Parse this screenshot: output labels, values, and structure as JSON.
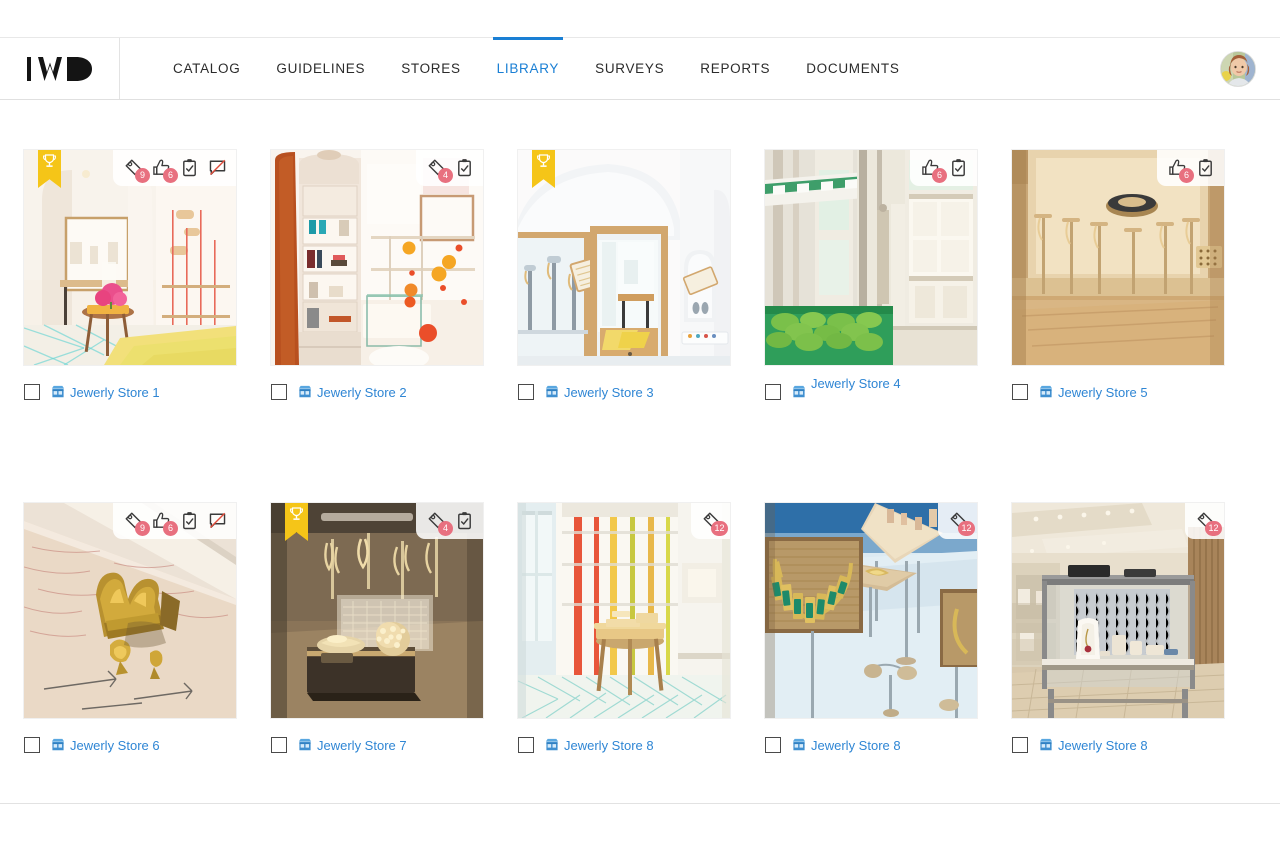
{
  "brand": {
    "logo_text": "IWD",
    "logo_icon": "iwd-wordmark"
  },
  "header": {
    "nav": [
      {
        "label": "CATALOG",
        "active": false,
        "name": "nav-item-catalog"
      },
      {
        "label": "GUIDELINES",
        "active": false,
        "name": "nav-item-guidelines"
      },
      {
        "label": "STORES",
        "active": false,
        "name": "nav-item-stores"
      },
      {
        "label": "LIBRARY",
        "active": true,
        "name": "nav-item-library"
      },
      {
        "label": "SURVEYS",
        "active": false,
        "name": "nav-item-surveys"
      },
      {
        "label": "REPORTS",
        "active": false,
        "name": "nav-item-reports"
      },
      {
        "label": "DOCUMENTS",
        "active": false,
        "name": "nav-item-documents"
      }
    ],
    "active_tab": "LIBRARY",
    "avatar_icon": "user-avatar-photo",
    "accent_color": "#1a7fd4"
  },
  "colors": {
    "accent": "#1a7fd4",
    "link": "#2f86d4",
    "ribbon": "#f5c518",
    "badge_count": "#e8707f",
    "strike": "#e04b3a",
    "text": "#2b2b2b"
  },
  "library": {
    "cards": [
      {
        "label": "Jewerly Store 1",
        "store_icon": "store-icon",
        "checked": false,
        "ribbon": true,
        "ribbon_icon": "trophy-icon",
        "label_raised": false,
        "badges": [
          {
            "icon": "tag-icon",
            "count": "9"
          },
          {
            "icon": "thumbs-up-icon",
            "count": "6"
          },
          {
            "icon": "clipboard-check-icon",
            "count": ""
          },
          {
            "icon": "comment-disabled-icon",
            "count": ""
          }
        ]
      },
      {
        "label": "Jewerly Store 2",
        "store_icon": "store-icon",
        "checked": false,
        "ribbon": false,
        "ribbon_icon": "",
        "label_raised": false,
        "badges": [
          {
            "icon": "tag-icon",
            "count": "4"
          },
          {
            "icon": "clipboard-check-icon",
            "count": ""
          }
        ]
      },
      {
        "label": "Jewerly Store 3",
        "store_icon": "store-icon",
        "checked": false,
        "ribbon": true,
        "ribbon_icon": "trophy-icon",
        "label_raised": false,
        "badges": []
      },
      {
        "label": "Jewerly Store 4",
        "store_icon": "store-icon",
        "checked": false,
        "ribbon": false,
        "ribbon_icon": "",
        "label_raised": true,
        "badges": [
          {
            "icon": "thumbs-up-icon",
            "count": "6"
          },
          {
            "icon": "clipboard-check-icon",
            "count": ""
          }
        ]
      },
      {
        "label": "Jewerly Store 5",
        "store_icon": "store-icon",
        "checked": false,
        "ribbon": false,
        "ribbon_icon": "",
        "label_raised": false,
        "badges": [
          {
            "icon": "thumbs-up-icon",
            "count": "6"
          },
          {
            "icon": "clipboard-check-icon",
            "count": ""
          }
        ]
      },
      {
        "label": "Jewerly Store 6",
        "store_icon": "store-icon",
        "checked": false,
        "ribbon": false,
        "ribbon_icon": "",
        "label_raised": false,
        "badges": [
          {
            "icon": "tag-icon",
            "count": "9"
          },
          {
            "icon": "thumbs-up-icon",
            "count": "6"
          },
          {
            "icon": "clipboard-check-icon",
            "count": ""
          },
          {
            "icon": "comment-disabled-icon",
            "count": ""
          }
        ]
      },
      {
        "label": "Jewerly Store 7",
        "store_icon": "store-icon",
        "checked": false,
        "ribbon": true,
        "ribbon_icon": "trophy-icon",
        "label_raised": false,
        "badges": [
          {
            "icon": "tag-icon",
            "count": "4"
          },
          {
            "icon": "clipboard-check-icon",
            "count": ""
          }
        ]
      },
      {
        "label": "Jewerly Store 8",
        "store_icon": "store-icon",
        "checked": false,
        "ribbon": false,
        "ribbon_icon": "",
        "label_raised": false,
        "badges": [
          {
            "icon": "tag-icon",
            "count": "12"
          }
        ]
      },
      {
        "label": "Jewerly Store 8",
        "store_icon": "store-icon",
        "checked": false,
        "ribbon": false,
        "ribbon_icon": "",
        "label_raised": false,
        "badges": [
          {
            "icon": "tag-icon",
            "count": "12"
          }
        ]
      },
      {
        "label": "Jewerly Store 8",
        "store_icon": "store-icon",
        "checked": false,
        "ribbon": false,
        "ribbon_icon": "",
        "label_raised": false,
        "badges": [
          {
            "icon": "tag-icon",
            "count": "12"
          }
        ]
      }
    ]
  }
}
